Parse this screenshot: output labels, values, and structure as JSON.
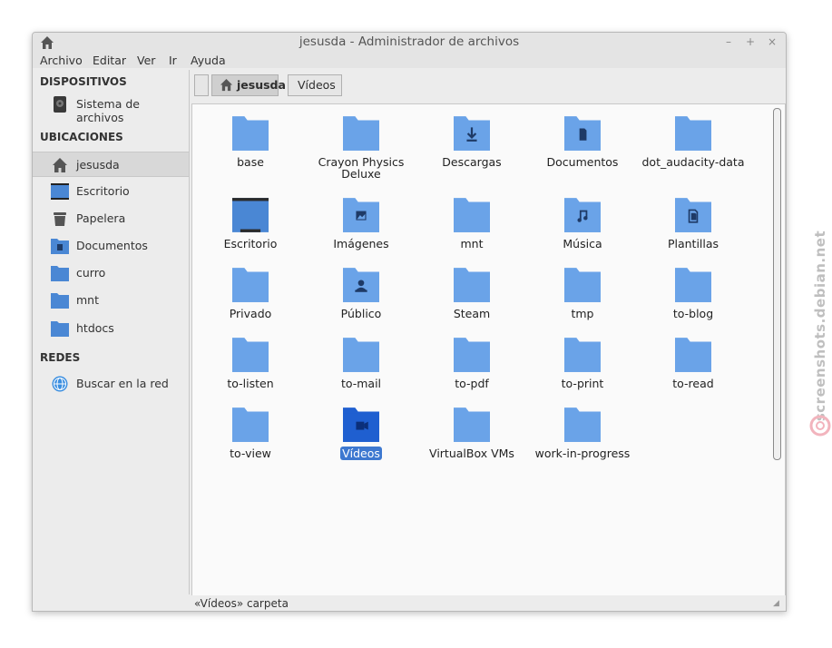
{
  "window": {
    "title": "jesusda - Administrador de archivos",
    "controls": {
      "minimize": "–",
      "maximize": "+",
      "close": "×"
    }
  },
  "menubar": [
    "Archivo",
    "Editar",
    "Ver",
    "Ir",
    "Ayuda"
  ],
  "sidebar": {
    "devices_header": "DISPOSITIVOS",
    "devices": [
      {
        "label": "Sistema de archivos",
        "icon": "drive-icon"
      }
    ],
    "places_header": "UBICACIONES",
    "places": [
      {
        "label": "jesusda",
        "icon": "home-icon",
        "active": true
      },
      {
        "label": "Escritorio",
        "icon": "desktop-icon"
      },
      {
        "label": "Papelera",
        "icon": "trash-icon"
      },
      {
        "label": "Documentos",
        "icon": "documents-folder-icon"
      },
      {
        "label": "curro",
        "icon": "folder-icon"
      },
      {
        "label": "mnt",
        "icon": "folder-icon"
      },
      {
        "label": "htdocs",
        "icon": "folder-icon"
      }
    ],
    "network_header": "REDES",
    "network": [
      {
        "label": "Buscar en la red",
        "icon": "globe-icon"
      }
    ]
  },
  "pathbar": {
    "home": "jesusda",
    "current": "Vídeos"
  },
  "files": [
    {
      "name": "base",
      "icon": "folder"
    },
    {
      "name": "Crayon Physics Deluxe",
      "icon": "folder"
    },
    {
      "name": "Descargas",
      "icon": "download"
    },
    {
      "name": "Documentos",
      "icon": "document"
    },
    {
      "name": "dot_audacity-data",
      "icon": "folder"
    },
    {
      "name": "Escritorio",
      "icon": "desktop"
    },
    {
      "name": "Imágenes",
      "icon": "image"
    },
    {
      "name": "mnt",
      "icon": "folder"
    },
    {
      "name": "Música",
      "icon": "music"
    },
    {
      "name": "Plantillas",
      "icon": "template"
    },
    {
      "name": "Privado",
      "icon": "folder"
    },
    {
      "name": "Público",
      "icon": "public"
    },
    {
      "name": "Steam",
      "icon": "folder"
    },
    {
      "name": "tmp",
      "icon": "folder"
    },
    {
      "name": "to-blog",
      "icon": "folder"
    },
    {
      "name": "to-listen",
      "icon": "folder"
    },
    {
      "name": "to-mail",
      "icon": "folder"
    },
    {
      "name": "to-pdf",
      "icon": "folder"
    },
    {
      "name": "to-print",
      "icon": "folder"
    },
    {
      "name": "to-read",
      "icon": "folder"
    },
    {
      "name": "to-view",
      "icon": "folder"
    },
    {
      "name": "Vídeos",
      "icon": "video",
      "selected": true
    },
    {
      "name": "VirtualBox VMs",
      "icon": "folder"
    },
    {
      "name": "work-in-progress",
      "icon": "folder"
    }
  ],
  "statusbar": {
    "text": "«Vídeos» carpeta"
  },
  "watermark": {
    "text": "screenshots.debian.net"
  },
  "colors": {
    "folder": "#6aa3e8",
    "folder_dark": "#4a87d4",
    "selected_folder": "#1f5fd0",
    "selection": "#3d78d0"
  }
}
